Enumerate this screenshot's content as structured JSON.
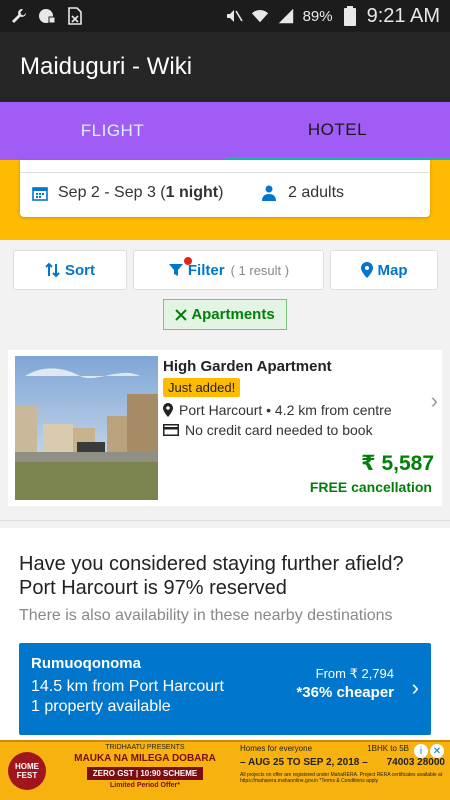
{
  "status_bar": {
    "battery": "89%",
    "time": "9:21 AM",
    "icons": [
      "wrench-icon",
      "shield-icon",
      "no-sim-icon",
      "mute-icon",
      "wifi-icon",
      "signal-icon",
      "battery-icon"
    ]
  },
  "app_bar": {
    "title": "Maiduguri - Wiki"
  },
  "tabs": [
    {
      "label": "FLIGHT",
      "selected": false
    },
    {
      "label": "HOTEL",
      "selected": true
    }
  ],
  "search": {
    "dates": "Sep 2 - Sep 3 (",
    "nights": "1 night",
    "dates_close": ")",
    "guests": "2 adults"
  },
  "controls": {
    "sort_label": "Sort",
    "filter_label": "Filter",
    "filter_count": "( 1 result )",
    "map_label": "Map"
  },
  "active_filter": {
    "label": "Apartments"
  },
  "hotel": {
    "name": "High Garden Apartment",
    "badge": "Just added!",
    "location": "Port Harcourt • 4.2 km from centre",
    "payment": "No credit card needed to book",
    "price": "₹ 5,587",
    "cancellation": "FREE cancellation"
  },
  "nearby": {
    "title": "Have you considered staying further afield? Port Harcourt is 97% reserved",
    "subtitle": "There is also availability in these nearby destinations",
    "card": {
      "name": "Rumuoqonoma",
      "distance": "14.5 km from Port Harcourt",
      "availability": "1 property available",
      "from": "From ₹ 2,794",
      "cheaper": "*36% cheaper"
    }
  },
  "ad": {
    "logo": "HOME FEST",
    "presents": "TRIDHAATU PRESENTS",
    "headline": "MAUKA NA MILEGA DOBARA",
    "scheme": "ZERO GST | 10:90 SCHEME",
    "offer": "Limited Period Offer*",
    "homes": "Homes for everyone",
    "bhk": "1BHK to 5B",
    "dates": "– AUG 25 TO SEP 2, 2018 –",
    "phone": "74003 28000",
    "fine_print": "All projects on offer are registered under MahaRERA. Project RERA certificates available at https://maharera.mahaonline.gov.in *Terms & Conditions apply"
  },
  "colors": {
    "tab_bar": "#a15cf6",
    "accent_yellow": "#febb02",
    "link_blue": "#0077cc",
    "price_green": "#008009"
  }
}
